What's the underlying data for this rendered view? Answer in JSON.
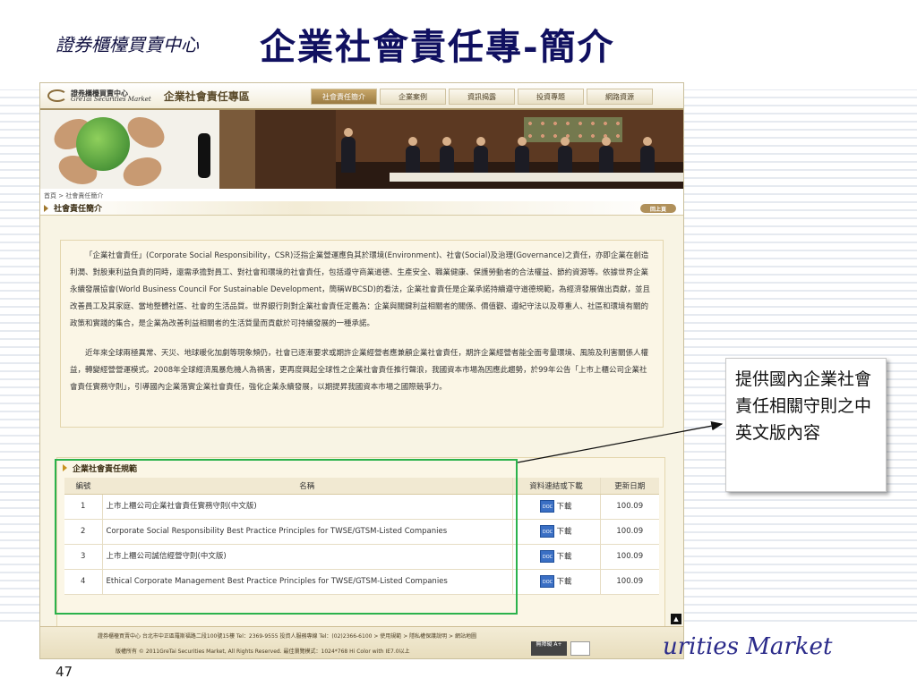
{
  "slide": {
    "org_label": "證券櫃檯買賣中心",
    "title": "企業社會責任專-簡介",
    "footer_text": "urities Market",
    "page_number": "47"
  },
  "site": {
    "logo_cn": "證券櫃檯買賣中心",
    "logo_en": "GreTai Securities Market",
    "zone_name": "企業社會責任專區",
    "nav": [
      {
        "label": "社會責任簡介",
        "active": true
      },
      {
        "label": "企業案例",
        "active": false
      },
      {
        "label": "資訊揭露",
        "active": false
      },
      {
        "label": "投資專題",
        "active": false
      },
      {
        "label": "網路資源",
        "active": false
      }
    ],
    "breadcrumb": "首頁 > 社會責任簡介",
    "section_title": "社會責任簡介",
    "back_label": "回上頁",
    "intro": [
      "「企業社會責任」(Corporate Social Responsibility，CSR)泛指企業營運應負其於環境(Environment)、社會(Social)及治理(Governance)之責任，亦即企業在創造利潤、對股東利益負責的同時，還需承擔對員工、對社會和環境的社會責任，包括遵守商業道德、生產安全、職業健康、保護勞動者的合法權益、節約資源等。依據世界企業永續發展協會(World Business Council For Sustainable Development，簡稱WBCSD)的看法，企業社會責任是企業承諾持續遵守道德規範，為經濟發展做出貢獻，並且改善員工及其家庭、當地整體社區、社會的生活品質。世界銀行則對企業社會責任定義為：企業與關鍵利益相關者的關係、價值觀、遵紀守法以及尊重人、社區和環境有關的政策和實踐的集合，是企業為改善利益相關者的生活質量而貢獻於可持續發展的一種承諾。",
      "近年來全球兩極異常、天災、地球暖化加劇等現象頻仍，社會已逐漸要求或期許企業經營者應兼顧企業社會責任，期許企業經營者能全面考量環境、風險及利害關係人權益，轉變經營營運模式。2008年全球經濟風暴危機人為禍害，更再度興起全球性之企業社會責任推行聲浪，我國資本市場為因應此趨勢，於99年公告「上市上櫃公司企業社會責任實務守則」，引導國內企業落實企業社會責任，強化企業永續發展，以期提昇我國資本市場之國際競爭力。"
    ],
    "spec": {
      "title": "企業社會責任規範",
      "headers": {
        "no": "編號",
        "name": "名稱",
        "dl": "資料連結或下載",
        "date": "更新日期"
      },
      "doc_icon_text": "DOC",
      "rows": [
        {
          "no": "1",
          "name": "上市上櫃公司企業社會責任實務守則(中文版)",
          "dl": "下載",
          "date": "100.09"
        },
        {
          "no": "2",
          "name": "Corporate Social Responsibility Best Practice Principles for TWSE/GTSM-Listed Companies",
          "dl": "下載",
          "date": "100.09"
        },
        {
          "no": "3",
          "name": "上市上櫃公司誠信經營守則(中文版)",
          "dl": "下載",
          "date": "100.09"
        },
        {
          "no": "4",
          "name": "Ethical Corporate Management Best Practice Principles for TWSE/GTSM-Listed Companies",
          "dl": "下載",
          "date": "100.09"
        }
      ]
    },
    "footer": {
      "line1": "證券櫃檯買賣中心 台北市中正區羅斯福路二段100號15樓 Tel：2369-9555 投資人服務專線 Tel：(02)2366-6100 > 使用規範 > 隱私權保護說明 > 網站地圖",
      "line2": "版權所有 © 2011GreTai Securities Market, All Rights Reserved. 最佳瀏覽模式：1024*768 Hi Color with IE7.0以上",
      "badge": "無障礙 A+"
    }
  },
  "callout": {
    "text": "提供國內企業社會責任相關守則之中英文版內容"
  },
  "colors": {
    "title": "#101060",
    "highlight_box": "#2bb24c",
    "nav_active": "#9a7a40"
  }
}
